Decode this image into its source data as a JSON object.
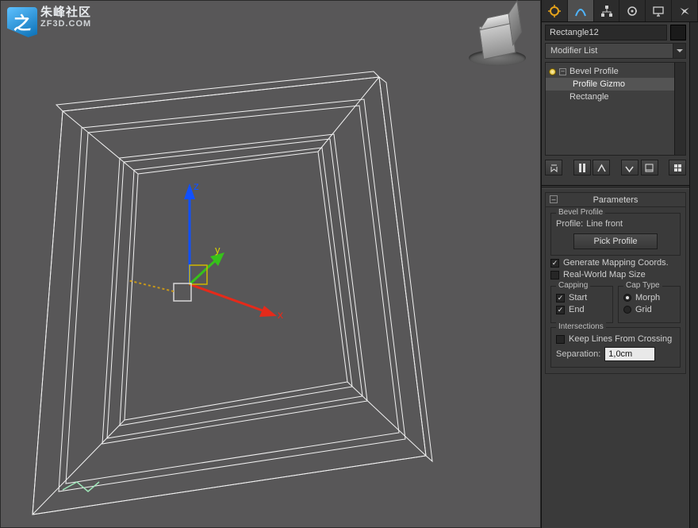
{
  "watermark": {
    "logo_char": "之",
    "line1": "朱峰社区",
    "line2": "ZF3D.COM"
  },
  "object_name": "Rectangle12",
  "modifier_list_label": "Modifier List",
  "tabs": {
    "create": "create-icon",
    "modify": "modify-icon",
    "hierarchy": "hierarchy-icon",
    "motion": "motion-icon",
    "display": "display-icon",
    "utilities": "utilities-icon"
  },
  "stack": {
    "items": [
      {
        "label": "Bevel Profile",
        "hasBulb": true,
        "expandable": true,
        "active": false
      },
      {
        "label": "Profile Gizmo",
        "child": true,
        "active": true
      },
      {
        "label": "Rectangle",
        "hasBulb": false,
        "active": false
      }
    ]
  },
  "parameters": {
    "title": "Parameters",
    "bevel_group_title": "Bevel Profile",
    "profile_label": "Profile:",
    "profile_value": "Line front",
    "pick_profile_btn": "Pick Profile",
    "gen_map_coords": {
      "label": "Generate Mapping Coords.",
      "checked": true
    },
    "real_world": {
      "label": "Real-World Map Size",
      "checked": false
    },
    "capping": {
      "title": "Capping",
      "start": {
        "label": "Start",
        "checked": true
      },
      "end": {
        "label": "End",
        "checked": true
      }
    },
    "cap_type": {
      "title": "Cap Type",
      "morph": {
        "label": "Morph",
        "on": true
      },
      "grid": {
        "label": "Grid",
        "on": false
      }
    },
    "intersections": {
      "title": "Intersections",
      "keep_lines": {
        "label": "Keep Lines From Crossing",
        "checked": false
      },
      "separation_label": "Separation:",
      "separation_value": "1,0cm"
    }
  },
  "gizmo_axes": {
    "x": "x",
    "y": "y",
    "z": "z"
  }
}
